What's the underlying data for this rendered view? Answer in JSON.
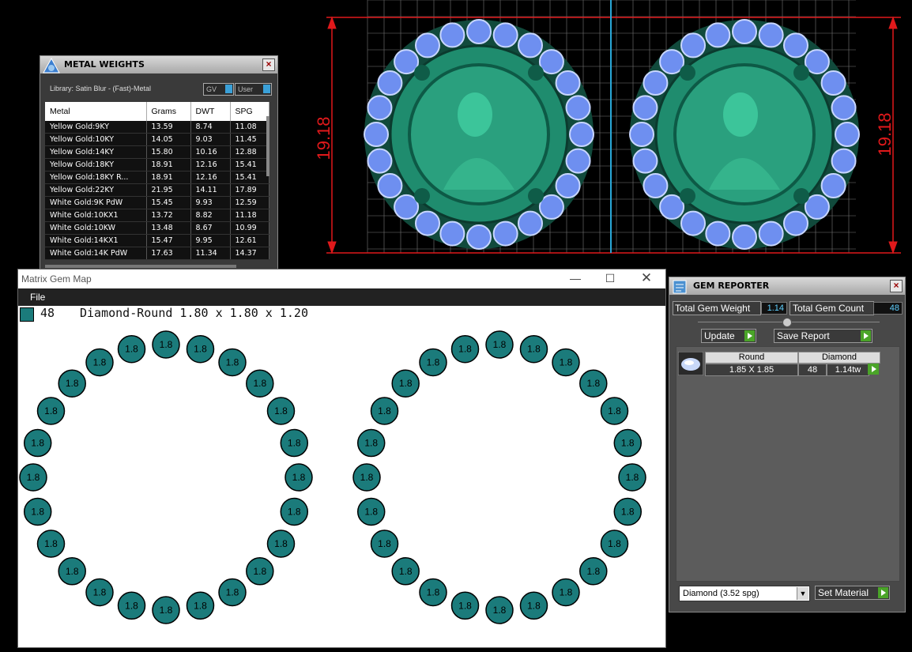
{
  "viewport": {
    "dimension_left": "19.18",
    "dimension_right": "19.18",
    "colors": {
      "dimension": "#e0191b",
      "gem": "#6e8ff0",
      "metal": "#1f8c6e",
      "grid": "#777777"
    }
  },
  "metal_weights": {
    "title": "METAL WEIGHTS",
    "library_label": "Library: Satin Blur - (Fast)-Metal",
    "dd1": "GV",
    "dd2": "User",
    "columns": [
      "Metal",
      "Grams",
      "DWT",
      "SPG"
    ],
    "rows": [
      [
        "Yellow Gold:9KY",
        "13.59",
        "8.74",
        "11.08"
      ],
      [
        "Yellow Gold:10KY",
        "14.05",
        "9.03",
        "11.45"
      ],
      [
        "Yellow Gold:14KY",
        "15.80",
        "10.16",
        "12.88"
      ],
      [
        "Yellow Gold:18KY",
        "18.91",
        "12.16",
        "15.41"
      ],
      [
        "Yellow Gold:18KY R...",
        "18.91",
        "12.16",
        "15.41"
      ],
      [
        "Yellow Gold:22KY",
        "21.95",
        "14.11",
        "17.89"
      ],
      [
        "White Gold:9K PdW",
        "15.45",
        "9.93",
        "12.59"
      ],
      [
        "White Gold:10KX1",
        "13.72",
        "8.82",
        "11.18"
      ],
      [
        "White Gold:10KW",
        "13.48",
        "8.67",
        "10.99"
      ],
      [
        "White Gold:14KX1",
        "15.47",
        "9.95",
        "12.61"
      ],
      [
        "White Gold:14K PdW",
        "17.63",
        "11.34",
        "14.37"
      ]
    ]
  },
  "gem_map": {
    "title": "Matrix Gem Map",
    "menu_file": "File",
    "legend_count": "48",
    "legend_desc": "Diamond-Round 1.80 x 1.80 x 1.20",
    "gem_label": "1.8",
    "gems_per_ring": 24,
    "gem_color": "#1b7b7b"
  },
  "gem_reporter": {
    "title": "GEM REPORTER",
    "total_weight_label": "Total Gem Weight",
    "total_weight_value": "1.14",
    "total_count_label": "Total Gem Count",
    "total_count_value": "48",
    "update_label": "Update",
    "save_label": "Save Report",
    "list_headers": [
      "Round",
      "Diamond"
    ],
    "row": {
      "size": "1.85 X 1.85",
      "count": "48",
      "weight": "1.14tw"
    },
    "material": "Diamond    (3.52 spg)",
    "set_material_label": "Set Material"
  }
}
